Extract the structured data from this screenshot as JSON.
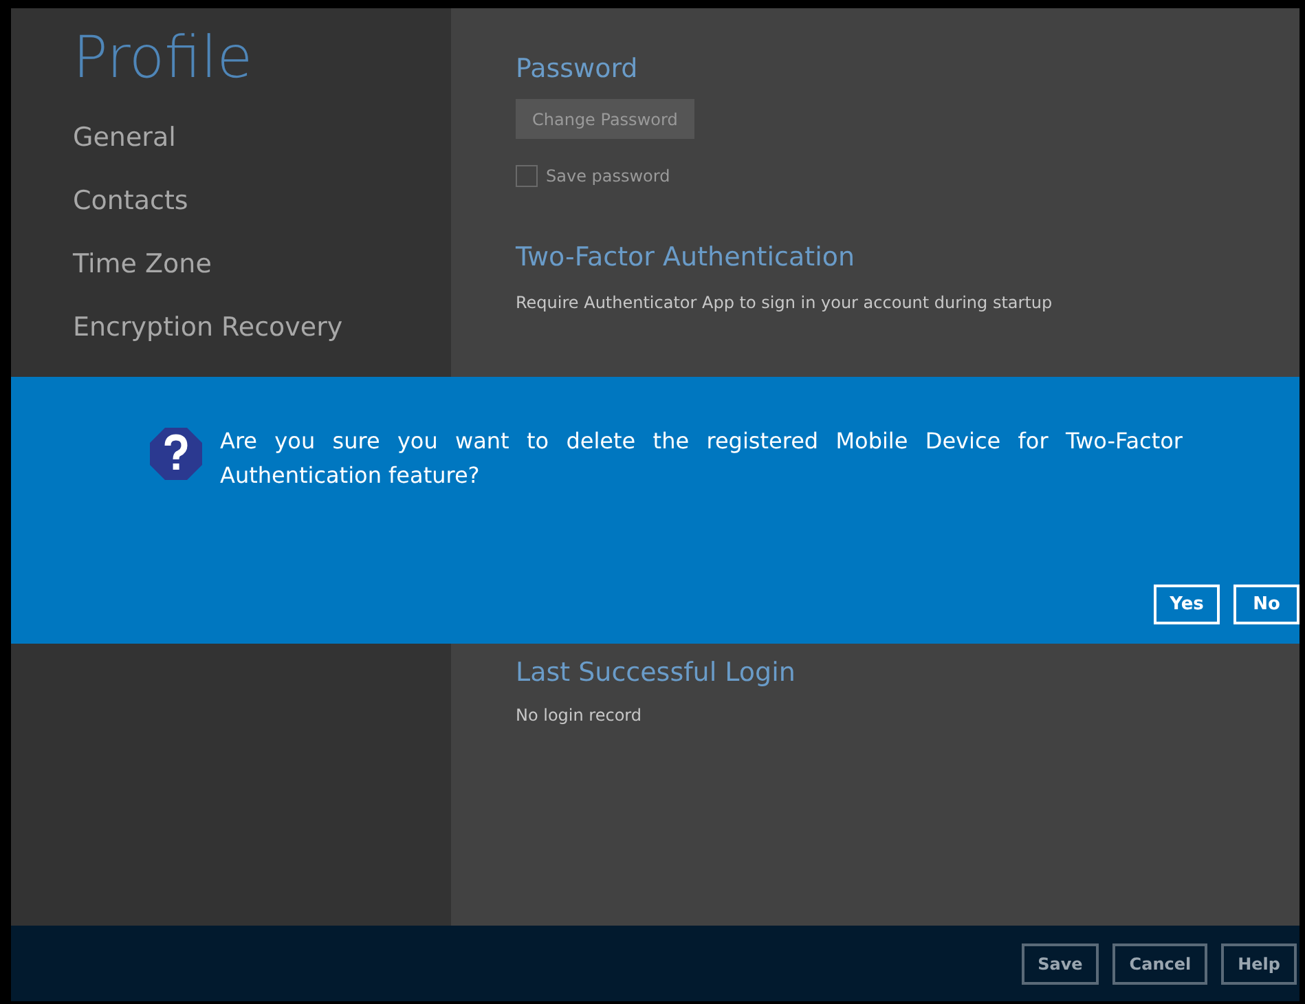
{
  "sidebar": {
    "title": "Profile",
    "items": [
      {
        "label": "General"
      },
      {
        "label": "Contacts"
      },
      {
        "label": "Time Zone"
      },
      {
        "label": "Encryption Recovery"
      }
    ]
  },
  "password": {
    "heading": "Password",
    "button": "Change Password",
    "save_password": {
      "label": "Save password",
      "checked": false
    }
  },
  "two_factor": {
    "heading": "Two-Factor Authentication",
    "description": "Require Authenticator App to sign in your account during startup"
  },
  "last_login": {
    "heading": "Last Successful Login",
    "text": "No login record"
  },
  "dialog": {
    "message": "Are you sure you want to delete the registered Mobile Device for Two-Factor Authentication feature?",
    "buttons": [
      "Yes",
      "No"
    ]
  },
  "footer": {
    "buttons": [
      "Save",
      "Cancel",
      "Help"
    ]
  }
}
